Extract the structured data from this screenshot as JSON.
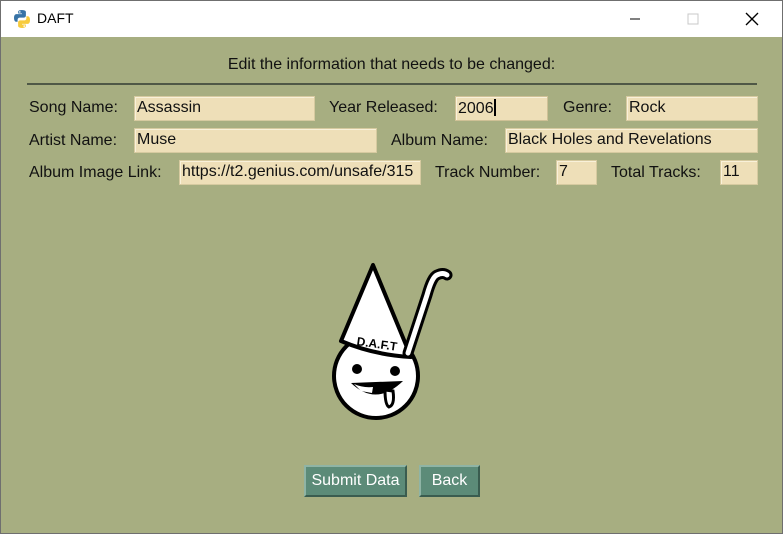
{
  "window": {
    "title": "DAFT",
    "icons": {
      "app": "python-icon",
      "minimize": "minimize-icon",
      "maximize": "maximize-icon",
      "close": "close-icon"
    }
  },
  "form": {
    "heading": "Edit the information that needs to be changed:",
    "song_name": {
      "label": "Song Name:",
      "value": "Assassin"
    },
    "year_released": {
      "label": "Year Released:",
      "value": "2006"
    },
    "genre": {
      "label": "Genre:",
      "value": "Rock"
    },
    "artist_name": {
      "label": "Artist Name:",
      "value": "Muse"
    },
    "album_name": {
      "label": "Album Name:",
      "value": "Black Holes and Revelations"
    },
    "album_image_link": {
      "label": "Album Image Link:",
      "value": "https://t2.genius.com/unsafe/315"
    },
    "track_number": {
      "label": "Track Number:",
      "value": "7"
    },
    "total_tracks": {
      "label": "Total Tracks:",
      "value": "11"
    }
  },
  "logo": {
    "text": "D.A.F.T"
  },
  "buttons": {
    "submit": "Submit Data",
    "back": "Back"
  },
  "colors": {
    "background": "#a7ae81",
    "field": "#eedfb8",
    "button": "#5c8b78"
  }
}
